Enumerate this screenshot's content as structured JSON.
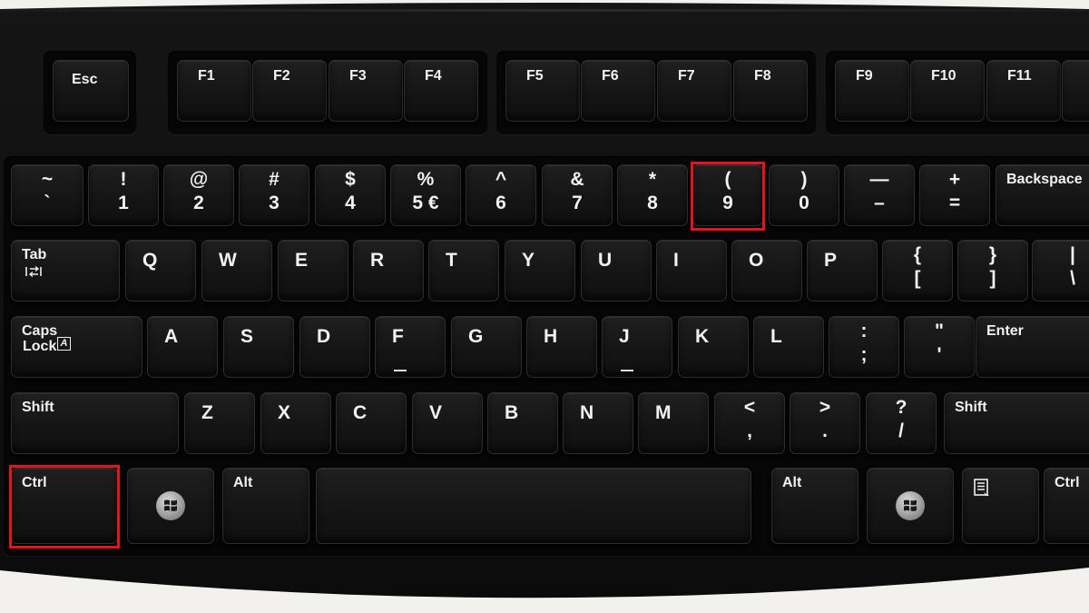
{
  "function_row": [
    {
      "id": "esc",
      "label": "Esc"
    },
    {
      "id": "f1",
      "label": "F1"
    },
    {
      "id": "f2",
      "label": "F2"
    },
    {
      "id": "f3",
      "label": "F3"
    },
    {
      "id": "f4",
      "label": "F4"
    },
    {
      "id": "f5",
      "label": "F5"
    },
    {
      "id": "f6",
      "label": "F6"
    },
    {
      "id": "f7",
      "label": "F7"
    },
    {
      "id": "f8",
      "label": "F8"
    },
    {
      "id": "f9",
      "label": "F9"
    },
    {
      "id": "f10",
      "label": "F10"
    },
    {
      "id": "f11",
      "label": "F11"
    },
    {
      "id": "f12",
      "label": ""
    }
  ],
  "number_row": [
    {
      "id": "backtick",
      "upper": "~",
      "lower": "`"
    },
    {
      "id": "1",
      "upper": "!",
      "lower": "1"
    },
    {
      "id": "2",
      "upper": "@",
      "lower": "2"
    },
    {
      "id": "3",
      "upper": "#",
      "lower": "3"
    },
    {
      "id": "4",
      "upper": "$",
      "lower": "4"
    },
    {
      "id": "5",
      "upper": "%",
      "lower": "5 €"
    },
    {
      "id": "6",
      "upper": "^",
      "lower": "6"
    },
    {
      "id": "7",
      "upper": "&",
      "lower": "7"
    },
    {
      "id": "8",
      "upper": "*",
      "lower": "8"
    },
    {
      "id": "9",
      "upper": "(",
      "lower": "9"
    },
    {
      "id": "0",
      "upper": ")",
      "lower": "0"
    },
    {
      "id": "minus",
      "upper": "—",
      "lower": "–"
    },
    {
      "id": "equals",
      "upper": "+",
      "lower": "="
    },
    {
      "id": "backspace",
      "label": "Backspace"
    }
  ],
  "qwerty_row": [
    {
      "id": "tab",
      "label": "Tab"
    },
    {
      "id": "q",
      "label": "Q"
    },
    {
      "id": "w",
      "label": "W"
    },
    {
      "id": "e",
      "label": "E"
    },
    {
      "id": "r",
      "label": "R"
    },
    {
      "id": "t",
      "label": "T"
    },
    {
      "id": "y",
      "label": "Y"
    },
    {
      "id": "u",
      "label": "U"
    },
    {
      "id": "i",
      "label": "I"
    },
    {
      "id": "o",
      "label": "O"
    },
    {
      "id": "p",
      "label": "P"
    },
    {
      "id": "lbrace",
      "upper": "{",
      "lower": "["
    },
    {
      "id": "rbrace",
      "upper": "}",
      "lower": "]"
    },
    {
      "id": "pipe",
      "upper": "|",
      "lower": "\\"
    }
  ],
  "home_row": [
    {
      "id": "capslock",
      "label": "Caps",
      "sublabel": "Lock",
      "icon_text": "A"
    },
    {
      "id": "a",
      "label": "A"
    },
    {
      "id": "s",
      "label": "S"
    },
    {
      "id": "d",
      "label": "D"
    },
    {
      "id": "f",
      "label": "F"
    },
    {
      "id": "g",
      "label": "G"
    },
    {
      "id": "h",
      "label": "H"
    },
    {
      "id": "j",
      "label": "J"
    },
    {
      "id": "k",
      "label": "K"
    },
    {
      "id": "l",
      "label": "L"
    },
    {
      "id": "semicolon",
      "upper": ":",
      "lower": ";"
    },
    {
      "id": "quote",
      "upper": "\"",
      "lower": "'"
    },
    {
      "id": "enter",
      "label": "Enter"
    }
  ],
  "shift_row": [
    {
      "id": "lshift",
      "label": "Shift"
    },
    {
      "id": "z",
      "label": "Z"
    },
    {
      "id": "x",
      "label": "X"
    },
    {
      "id": "c",
      "label": "C"
    },
    {
      "id": "v",
      "label": "V"
    },
    {
      "id": "b",
      "label": "B"
    },
    {
      "id": "n",
      "label": "N"
    },
    {
      "id": "m",
      "label": "M"
    },
    {
      "id": "comma",
      "upper": "<",
      "lower": ","
    },
    {
      "id": "period",
      "upper": ">",
      "lower": "."
    },
    {
      "id": "slash",
      "upper": "?",
      "lower": "/"
    },
    {
      "id": "rshift",
      "label": "Shift"
    }
  ],
  "bottom_row": [
    {
      "id": "lctrl",
      "label": "Ctrl"
    },
    {
      "id": "lwin",
      "label": "",
      "icon": "windows-logo-icon"
    },
    {
      "id": "lalt",
      "label": "Alt"
    },
    {
      "id": "space",
      "label": ""
    },
    {
      "id": "ralt",
      "label": "Alt"
    },
    {
      "id": "rwin",
      "label": "",
      "icon": "windows-logo-icon"
    },
    {
      "id": "menu",
      "label": "",
      "icon": "context-menu-icon"
    },
    {
      "id": "rctrl",
      "label": "Ctrl"
    }
  ],
  "highlighted_keys": [
    "9",
    "lctrl"
  ],
  "highlight_color": "#e0161c",
  "key_color": "#161616",
  "legend_color": "#f2f2f2"
}
